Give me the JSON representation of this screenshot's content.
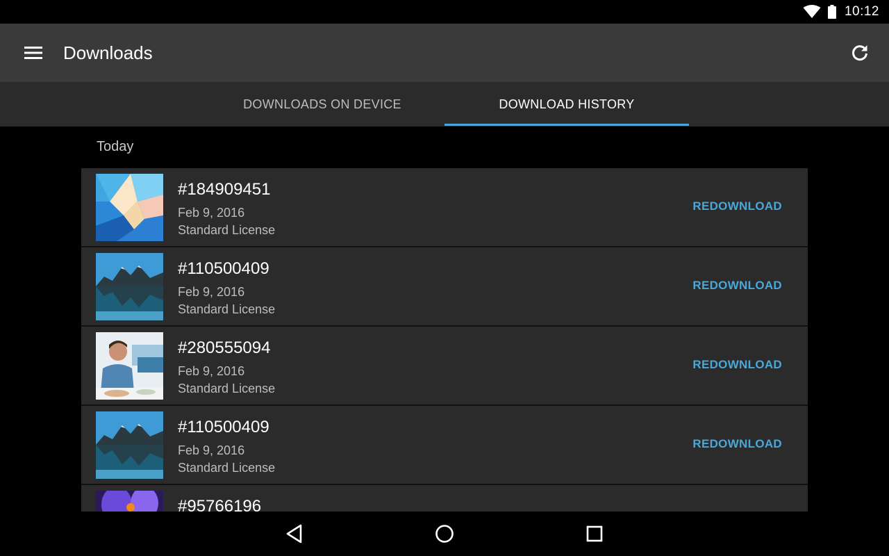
{
  "status_bar": {
    "time": "10:12",
    "wifi_icon": "wifi-icon",
    "battery_icon": "battery-icon"
  },
  "toolbar": {
    "title": "Downloads",
    "menu_icon": "hamburger-menu-icon",
    "refresh_icon": "refresh-icon"
  },
  "tabs": [
    {
      "label": "DOWNLOADS ON DEVICE",
      "active": false
    },
    {
      "label": "DOWNLOAD HISTORY",
      "active": true
    }
  ],
  "section": {
    "header": "Today"
  },
  "items": [
    {
      "id": "#184909451",
      "date": "Feb 9, 2016",
      "license": "Standard License",
      "action": "REDOWNLOAD",
      "thumb": "polygon"
    },
    {
      "id": "#110500409",
      "date": "Feb 9, 2016",
      "license": "Standard License",
      "action": "REDOWNLOAD",
      "thumb": "mountain"
    },
    {
      "id": "#280555094",
      "date": "Feb 9, 2016",
      "license": "Standard License",
      "action": "REDOWNLOAD",
      "thumb": "people"
    },
    {
      "id": "#110500409",
      "date": "Feb 9, 2016",
      "license": "Standard License",
      "action": "REDOWNLOAD",
      "thumb": "mountain"
    },
    {
      "id": "#95766196",
      "date": "",
      "license": "",
      "action": "",
      "thumb": "flower"
    }
  ],
  "navbar": {
    "back_icon": "back-triangle-icon",
    "home_icon": "home-circle-icon",
    "recents_icon": "recents-square-icon"
  },
  "colors": {
    "accent": "#4aa8d8",
    "toolbar": "#3a3a3a",
    "tabs_bg": "#2b2b2b",
    "row_bg": "#2b2b2b"
  }
}
